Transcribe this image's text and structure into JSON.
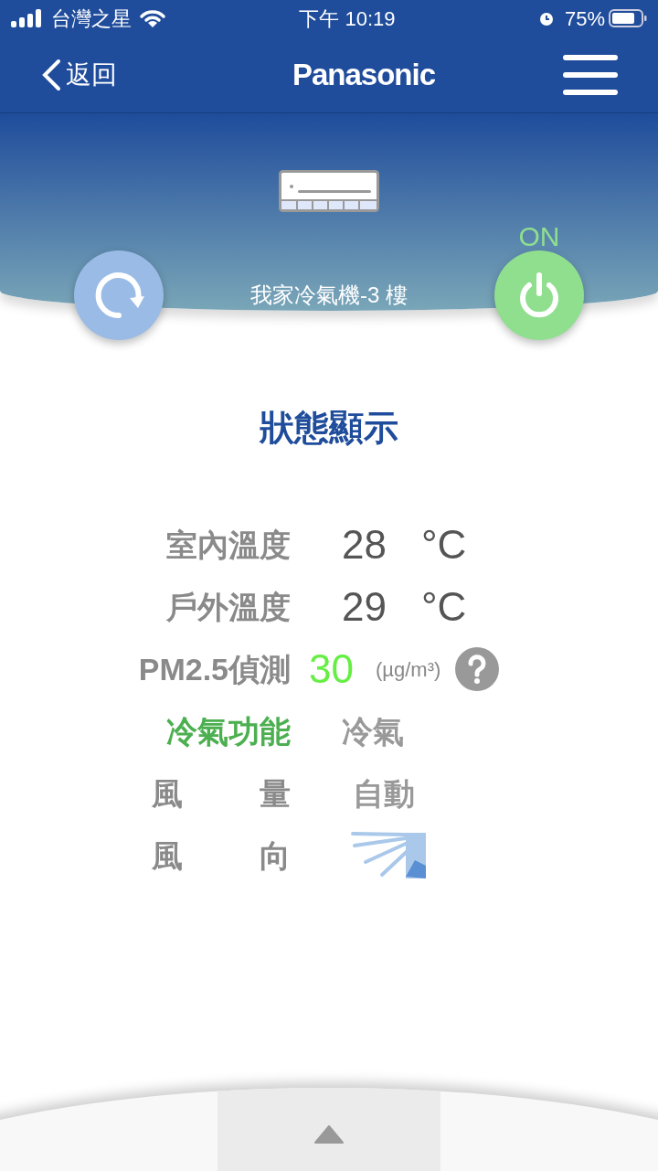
{
  "status_bar": {
    "carrier": "台灣之星",
    "time": "下午 10:19",
    "battery": "75%"
  },
  "nav": {
    "back": "返回",
    "logo": "Panasonic"
  },
  "device": {
    "name": "我家冷氣機-3 樓",
    "power_label": "ON",
    "power_on": true
  },
  "section_title": "狀態顯示",
  "rows": [
    {
      "kind": "value",
      "label": "室內溫度",
      "value": "28",
      "unit": "°C"
    },
    {
      "kind": "value",
      "label": "戶外溫度",
      "value": "29",
      "unit": "°C"
    },
    {
      "kind": "pm",
      "label": "PM2.5偵測",
      "value": "30",
      "unit": "(µg/m³)"
    },
    {
      "kind": "mode",
      "label": "冷氣功能",
      "value": "冷氣"
    },
    {
      "kind": "split",
      "label_parts": [
        "風",
        "量"
      ],
      "value": "自動"
    },
    {
      "kind": "direction",
      "label_parts": [
        "風",
        "向"
      ]
    }
  ]
}
